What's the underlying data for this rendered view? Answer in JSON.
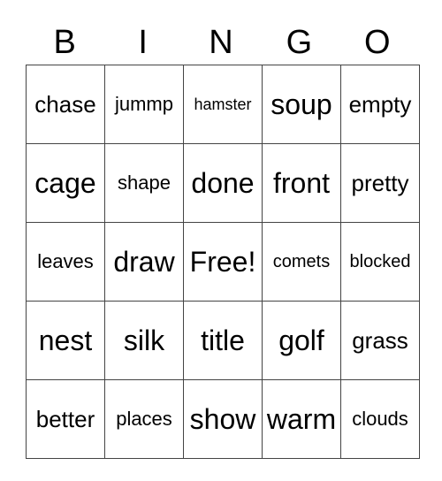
{
  "header": {
    "letters": [
      "B",
      "I",
      "N",
      "G",
      "O"
    ]
  },
  "grid": {
    "rows": [
      [
        "chase",
        "jummp",
        "hamster",
        "soup",
        "empty"
      ],
      [
        "cage",
        "shape",
        "done",
        "front",
        "pretty"
      ],
      [
        "leaves",
        "draw",
        "Free!",
        "comets",
        "blocked"
      ],
      [
        "nest",
        "silk",
        "title",
        "golf",
        "grass"
      ],
      [
        "better",
        "places",
        "show",
        "warm",
        "clouds"
      ]
    ]
  }
}
